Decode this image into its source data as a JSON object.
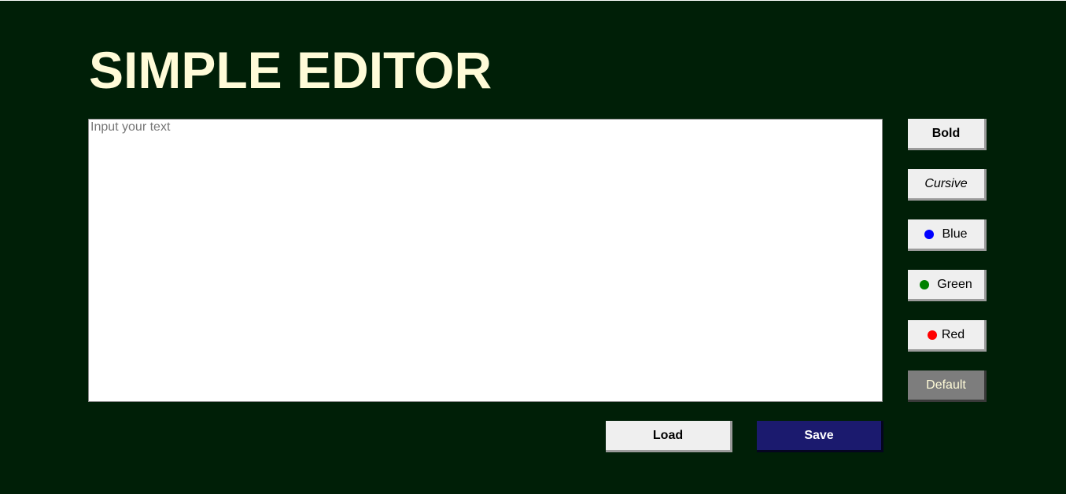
{
  "header": {
    "title": "SIMPLE EDITOR"
  },
  "editor": {
    "placeholder": "Input your text",
    "value": ""
  },
  "formatting": {
    "bold_label": "Bold",
    "cursive_label": "Cursive",
    "colors": [
      {
        "label": "Blue",
        "color": "#0000ff"
      },
      {
        "label": "Green",
        "color": "#008000"
      },
      {
        "label": "Red",
        "color": "#ff0000"
      }
    ],
    "default_label": "Default"
  },
  "actions": {
    "load_label": "Load",
    "save_label": "Save"
  },
  "theme": {
    "background": "#001f07",
    "title_color": "#fffbd8",
    "save_button": "#1b1a6e",
    "default_button": "#7d7d7d"
  }
}
